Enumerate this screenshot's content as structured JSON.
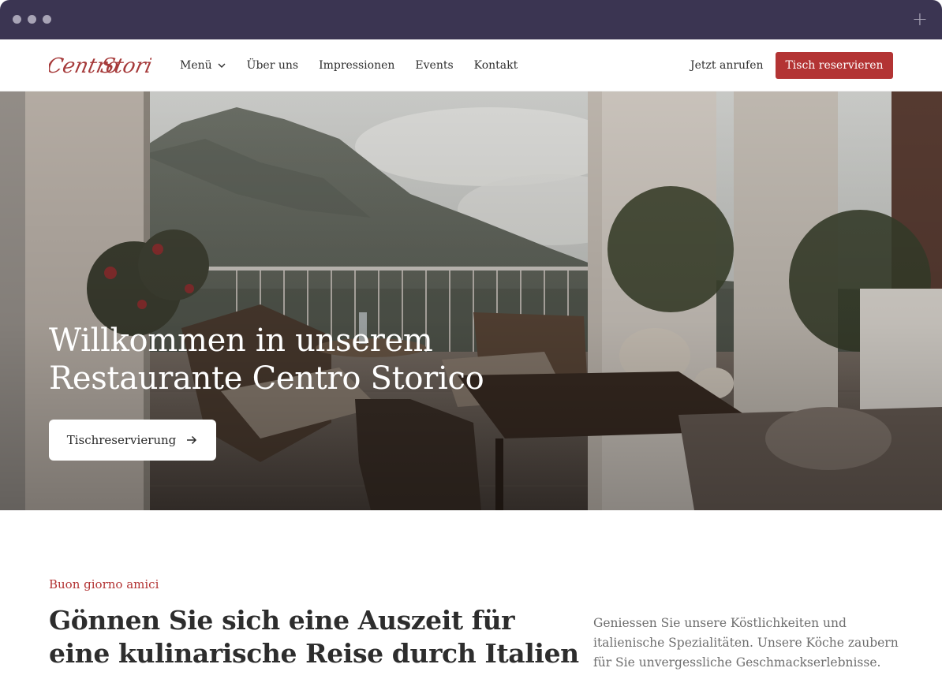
{
  "browser": {
    "new_tab_icon": "plus-icon"
  },
  "header": {
    "logo_text_1": "Centro",
    "logo_text_2": "Storico",
    "logo_color": "#a63a3a",
    "nav": [
      {
        "label": "Menü",
        "icon": "chevron-down-icon"
      },
      {
        "label": "Über uns"
      },
      {
        "label": "Impressionen"
      },
      {
        "label": "Events"
      },
      {
        "label": "Kontakt"
      }
    ],
    "call_label": "Jetzt anrufen",
    "reserve_label": "Tisch reservieren"
  },
  "hero": {
    "title_line_1": "Willkommen in unserem",
    "title_line_2": "Restaurante Centro Storico",
    "button_label": "Tischreservierung",
    "button_icon": "arrow-right-icon"
  },
  "intro": {
    "eyebrow": "Buon giorno amici",
    "headline_line_1": "Gönnen Sie sich eine Auszeit für",
    "headline_line_2": "eine kulinarische Reise durch Italien",
    "text_line_1": "Geniessen Sie unsere Köstlichkeiten und",
    "text_line_2": "italienische Spezialitäten. Unsere Köche zaubern",
    "text_line_3": "für Sie unvergessliche Geschmackserlebnisse."
  },
  "colors": {
    "accent": "#b33434",
    "chrome": "#3b3552"
  }
}
